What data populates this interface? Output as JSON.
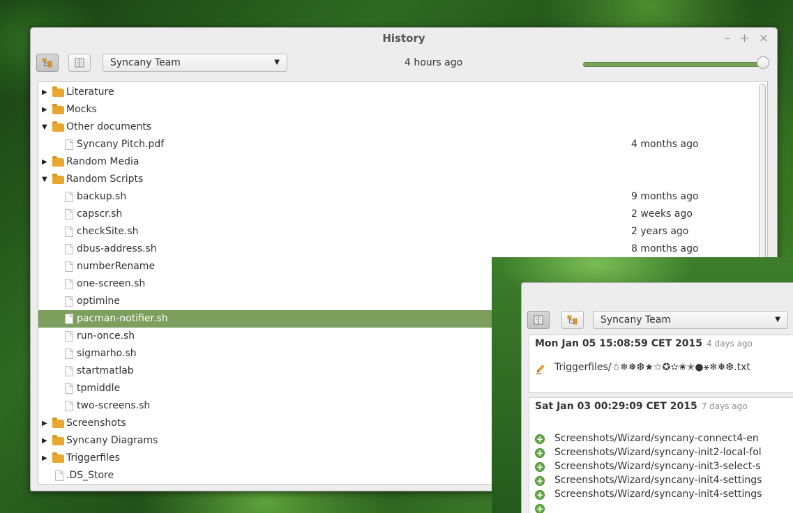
{
  "main_window": {
    "title": "History",
    "controls": {
      "minimize": "–",
      "maximize": "+",
      "close": "×"
    },
    "toolbar": {
      "view_buttons": [
        {
          "name": "tree-view-button",
          "icon": "tree-view-icon",
          "active": true
        },
        {
          "name": "log-view-button",
          "icon": "book-icon",
          "active": false
        }
      ],
      "folder_select": "Syncany Team",
      "time_label": "4 hours ago",
      "slider_value": 1.0
    },
    "tree": [
      {
        "type": "folder",
        "label": "Literature",
        "expanded": false,
        "depth": 0,
        "meta": ""
      },
      {
        "type": "folder",
        "label": "Mocks",
        "expanded": false,
        "depth": 0,
        "meta": ""
      },
      {
        "type": "folder",
        "label": "Other documents",
        "expanded": true,
        "depth": 0,
        "meta": ""
      },
      {
        "type": "file",
        "label": "Syncany Pitch.pdf",
        "depth": 1,
        "meta": "4 months ago"
      },
      {
        "type": "folder",
        "label": "Random Media",
        "expanded": false,
        "depth": 0,
        "meta": ""
      },
      {
        "type": "folder",
        "label": "Random Scripts",
        "expanded": true,
        "depth": 0,
        "meta": ""
      },
      {
        "type": "file",
        "label": "backup.sh",
        "depth": 1,
        "meta": "9 months ago"
      },
      {
        "type": "file",
        "label": "capscr.sh",
        "depth": 1,
        "meta": "2 weeks ago"
      },
      {
        "type": "file",
        "label": "checkSite.sh",
        "depth": 1,
        "meta": "2 years ago"
      },
      {
        "type": "file",
        "label": "dbus-address.sh",
        "depth": 1,
        "meta": "8 months ago"
      },
      {
        "type": "file",
        "label": "numberRename",
        "depth": 1,
        "meta": ""
      },
      {
        "type": "file",
        "label": "one-screen.sh",
        "depth": 1,
        "meta": ""
      },
      {
        "type": "file",
        "label": "optimine",
        "depth": 1,
        "meta": ""
      },
      {
        "type": "file",
        "label": "pacman-notifier.sh",
        "depth": 1,
        "meta": "",
        "selected": true
      },
      {
        "type": "file",
        "label": "run-once.sh",
        "depth": 1,
        "meta": ""
      },
      {
        "type": "file",
        "label": "sigmarho.sh",
        "depth": 1,
        "meta": ""
      },
      {
        "type": "file",
        "label": "startmatlab",
        "depth": 1,
        "meta": ""
      },
      {
        "type": "file",
        "label": "tpmiddle",
        "depth": 1,
        "meta": ""
      },
      {
        "type": "file",
        "label": "two-screens.sh",
        "depth": 1,
        "meta": ""
      },
      {
        "type": "folder",
        "label": "Screenshots",
        "expanded": false,
        "depth": 0,
        "meta": ""
      },
      {
        "type": "folder",
        "label": "Syncany Diagrams",
        "expanded": false,
        "depth": 0,
        "meta": ""
      },
      {
        "type": "folder",
        "label": "Triggerfiles",
        "expanded": false,
        "depth": 0,
        "meta": ""
      },
      {
        "type": "file",
        "label": ".DS_Store",
        "depth": 0,
        "meta": ""
      }
    ]
  },
  "second_window": {
    "toolbar": {
      "view_buttons": [
        {
          "name": "log-view-button",
          "icon": "book-icon",
          "active": true
        },
        {
          "name": "tree-view-button",
          "icon": "tree-view-icon",
          "active": false
        }
      ],
      "folder_select": "Syncany Team"
    },
    "entries": [
      {
        "date": "Mon Jan 05 15:08:59 CET 2015",
        "ago": "4 days ago",
        "changes": [
          {
            "kind": "edit",
            "icon": "pencil-icon",
            "path": "Triggerfiles/☃❄❅❆★☆✪✫✬✭●⚹❄❅❆.txt"
          }
        ]
      },
      {
        "date": "Sat Jan 03 00:29:09 CET 2015",
        "ago": "7 days ago",
        "changes": [
          {
            "kind": "add",
            "icon": "plus-circle-icon",
            "path": "Screenshots/Wizard/syncany-connect4-en"
          },
          {
            "kind": "add",
            "icon": "plus-circle-icon",
            "path": "Screenshots/Wizard/syncany-init2-local-fol"
          },
          {
            "kind": "add",
            "icon": "plus-circle-icon",
            "path": "Screenshots/Wizard/syncany-init3-select-s"
          },
          {
            "kind": "add",
            "icon": "plus-circle-icon",
            "path": "Screenshots/Wizard/syncany-init4-settings"
          },
          {
            "kind": "add",
            "icon": "plus-circle-icon",
            "path": "Screenshots/Wizard/syncany-init4-settings"
          }
        ]
      }
    ]
  }
}
